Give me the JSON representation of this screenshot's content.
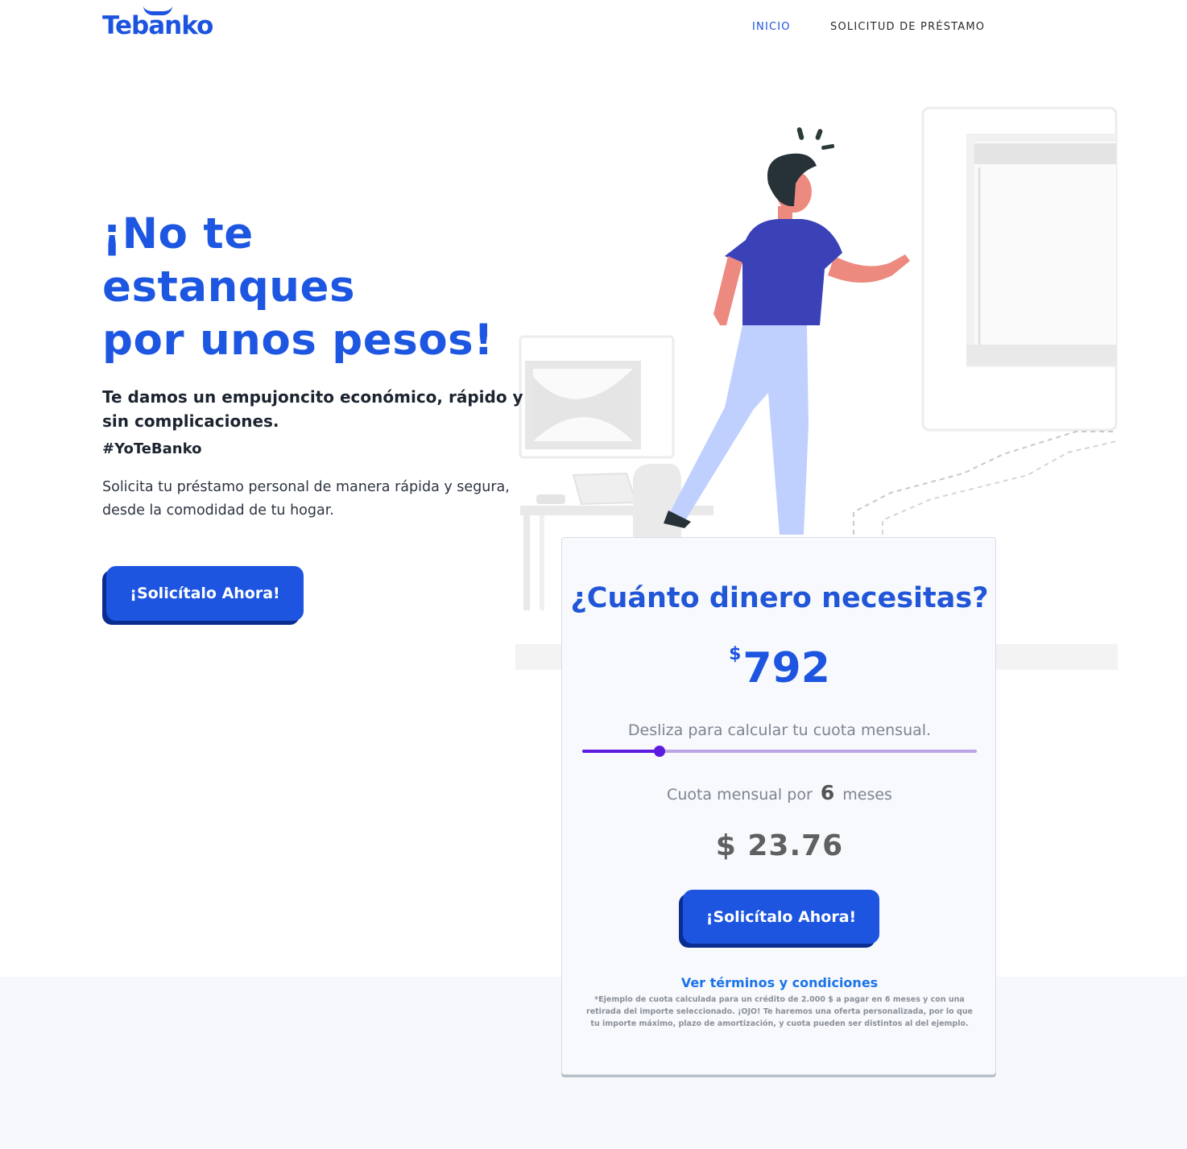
{
  "brand": {
    "name": "Tebanko",
    "color": "#1c54e0"
  },
  "nav": {
    "items": [
      {
        "label": "INICIO",
        "active": true
      },
      {
        "label": "SOLICITUD DE PRÉSTAMO",
        "active": false
      }
    ]
  },
  "hero": {
    "title_lines": [
      "¡No te",
      "estanques",
      "por unos pesos!"
    ],
    "subtitle": "Te damos un empujoncito económico, rápido y sin complicaciones.",
    "hashtag": "#YoTeBanko",
    "body": "Solicita tu préstamo personal de manera rápida y segura, desde la comodidad de tu hogar.",
    "cta_label": "¡Solicítalo Ahora!"
  },
  "calculator": {
    "title": "¿Cuánto dinero necesitas?",
    "currency_symbol": "$",
    "amount": "792",
    "slider_hint": "Desliza para calcular tu cuota mensual.",
    "slider_level": 0.195,
    "cuota_prefix": "Cuota mensual por",
    "months": "6",
    "cuota_suffix": "meses",
    "monthly_payment": "$ 23.76",
    "cta_label": "¡Solicítalo Ahora!",
    "terms_link": "Ver términos y condiciones",
    "disclaimer": "*Ejemplo de cuota calculada para un crédito de 2.000 $ a pagar en 6 meses y con una retirada del importe seleccionado. ¡OJO! Te haremos una oferta personalizada, por lo que tu importe máximo, plazo de amortización, y cuota pueden ser distintos al del ejemplo."
  },
  "colors": {
    "primary": "#1d55e0",
    "slider_active": "#5e1be0",
    "slider_track": "#b9a5e6",
    "link": "#1a73e8"
  }
}
